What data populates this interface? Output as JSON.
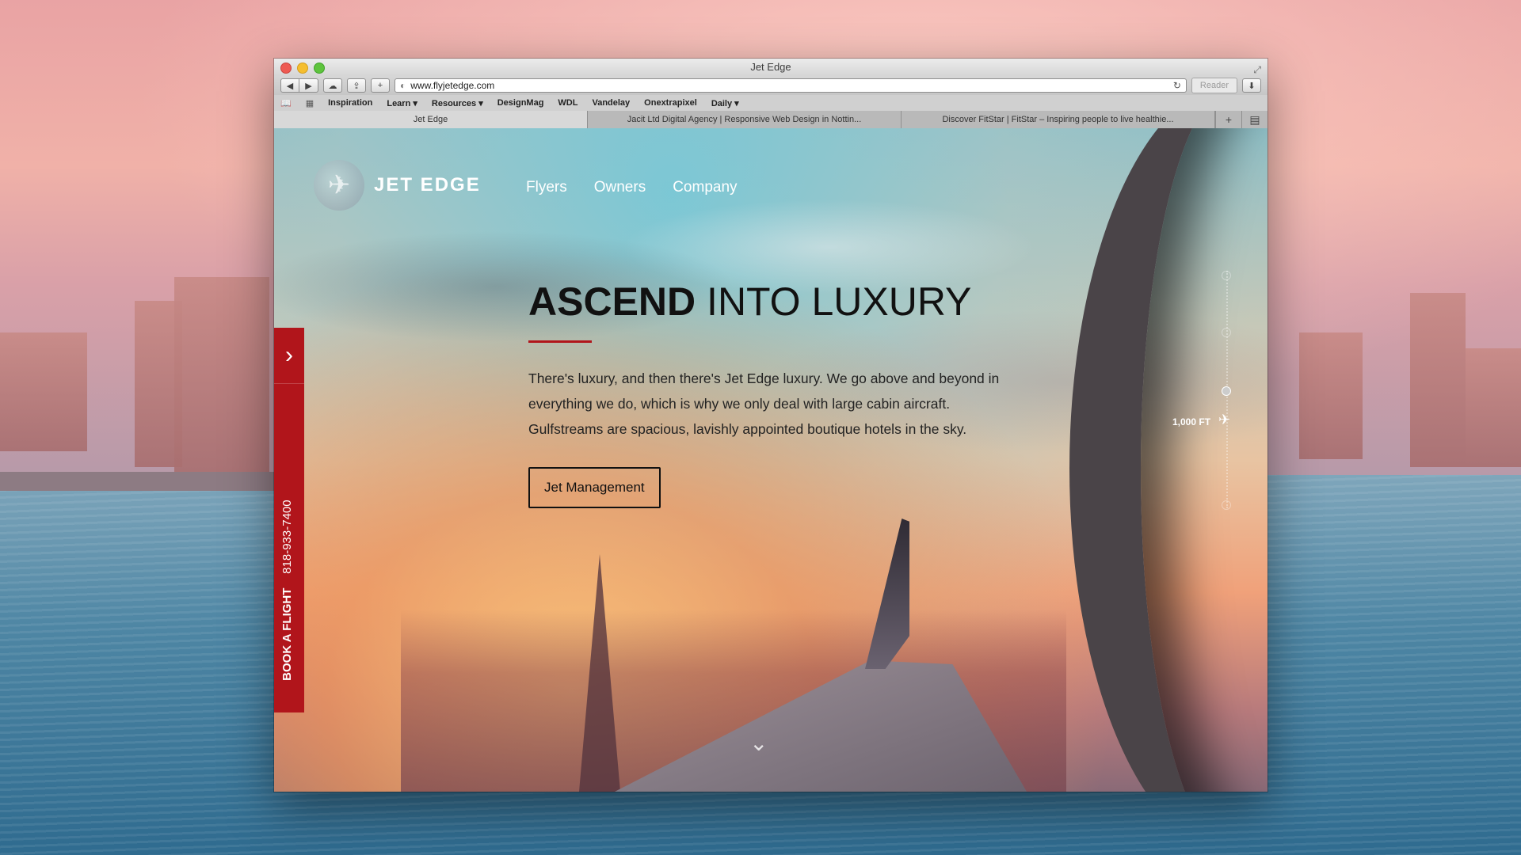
{
  "window": {
    "title": "Jet Edge"
  },
  "address_bar": {
    "url": "www.flyjetedge.com",
    "reader_label": "Reader"
  },
  "bookmarks": [
    "Inspiration",
    "Learn ▾",
    "Resources ▾",
    "DesignMag",
    "WDL",
    "Vandelay",
    "Onextrapixel",
    "Daily ▾"
  ],
  "tabs": [
    {
      "label": "Jet Edge",
      "active": true
    },
    {
      "label": "Jacit Ltd Digital Agency | Responsive Web Design in Nottin...",
      "active": false
    },
    {
      "label": "Discover FitStar | FitStar – Inspiring people to live healthie...",
      "active": false
    }
  ],
  "site": {
    "logo_text": "JET EDGE",
    "nav": [
      "Flyers",
      "Owners",
      "Company"
    ],
    "book_tab": {
      "label": "BOOK A FLIGHT",
      "phone": "818-933-7400"
    },
    "headline_bold": "ASCEND",
    "headline_light": "INTO LUXURY",
    "body": "There's luxury, and then there's Jet Edge luxury. We go above and beyond in everything we do, which is why we only deal with large cabin aircraft. Gulfstreams are spacious, lavishly appointed boutique hotels in the sky.",
    "cta_label": "Jet Management",
    "altitude_label": "1,000 FT"
  },
  "icons": {
    "back": "◀",
    "forward": "▶",
    "cloud": "☁",
    "share": "⇪",
    "add": "+",
    "refresh": "↻",
    "download": "⬇",
    "book": "📖",
    "grid": "▦",
    "tab_plus": "+",
    "tab_list": "▤",
    "chevron_right": "›",
    "plane": "✈",
    "chevron_down": "⌄",
    "logo_mark": "✈"
  },
  "colors": {
    "brand_red": "#b1151b",
    "text_dark": "#111111"
  }
}
